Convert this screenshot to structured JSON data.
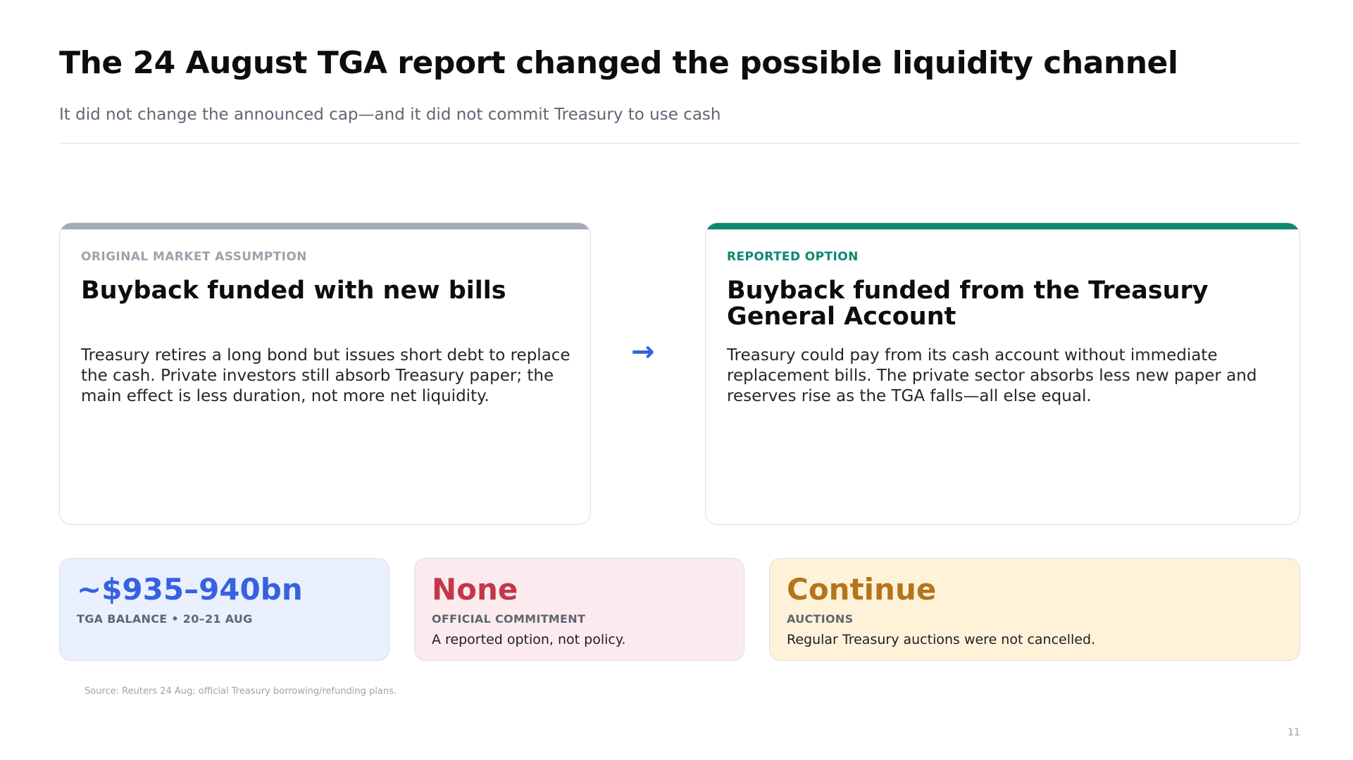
{
  "header": {
    "title": "The 24 August TGA report changed the possible liquidity channel",
    "subtitle": "It did not change the announced cap—and it did not commit Treasury to use cash"
  },
  "cards": {
    "left": {
      "tag": "ORIGINAL MARKET ASSUMPTION",
      "heading": "Buyback funded with new bills",
      "body": "Treasury retires a long bond but issues short debt to replace the cash. Private investors still absorb Treasury paper; the main effect is less duration, not more net liquidity."
    },
    "arrow": "→",
    "right": {
      "tag": "REPORTED OPTION",
      "heading": "Buyback funded from the Treasury General Account",
      "body": "Treasury could pay from its cash account without immediate replacement bills. The private sector absorbs less new paper and reserves rise as the TGA falls—all else equal."
    }
  },
  "stats": [
    {
      "value": "~$935–940bn",
      "label": "TGA BALANCE • 20–21 AUG",
      "note": ""
    },
    {
      "value": "None",
      "label": "OFFICIAL COMMITMENT",
      "note": "A reported option, not policy."
    },
    {
      "value": "Continue",
      "label": "AUCTIONS",
      "note": "Regular Treasury auctions were not cancelled."
    }
  ],
  "footer": {
    "source": "Source: Reuters 24 Aug; official Treasury borrowing/refunding plans.",
    "page_number": "11"
  },
  "colors": {
    "accent_blue": "#3562e0",
    "accent_green": "#0e8772",
    "accent_red": "#c4374b",
    "accent_amber": "#b5751d"
  }
}
